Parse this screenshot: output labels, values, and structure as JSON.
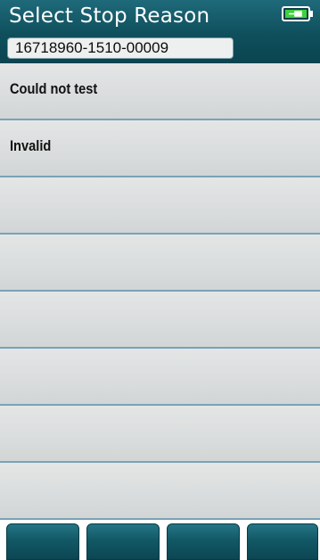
{
  "header": {
    "title": "Select Stop Reason",
    "record_id": "16718960-1510-00009",
    "battery_icon": "battery-charging-icon",
    "accent_color": "#0f4f5c"
  },
  "list": {
    "items": [
      {
        "label": "Could not test"
      },
      {
        "label": "Invalid"
      },
      {
        "label": ""
      },
      {
        "label": ""
      },
      {
        "label": ""
      },
      {
        "label": ""
      },
      {
        "label": ""
      },
      {
        "label": ""
      }
    ]
  },
  "softkeys": [
    {
      "label": ""
    },
    {
      "label": ""
    },
    {
      "label": ""
    },
    {
      "label": ""
    }
  ]
}
